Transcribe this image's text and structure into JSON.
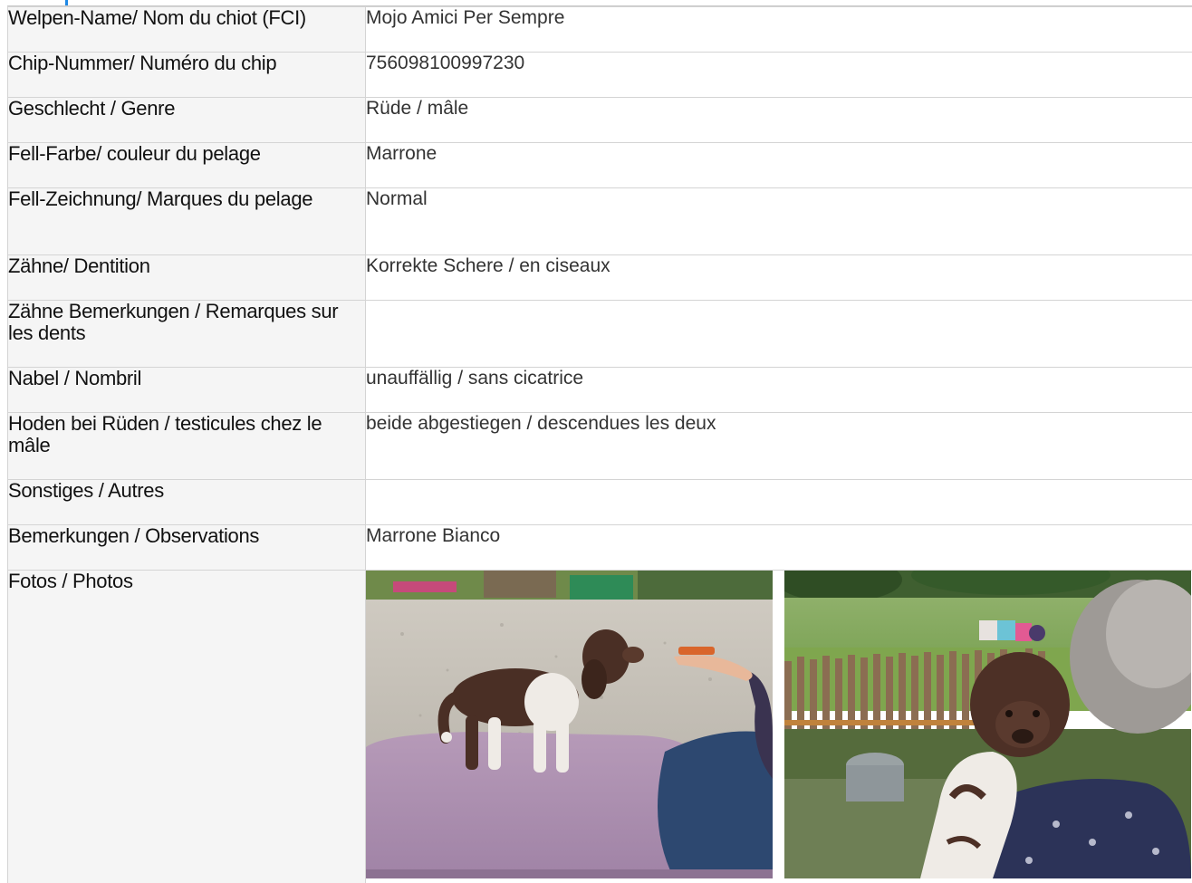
{
  "rows": [
    {
      "label": "Welpen-Name/ Nom du chiot (FCI)",
      "value": "Mojo Amici Per Sempre"
    },
    {
      "label": "Chip-Nummer/ Numéro du chip",
      "value": "756098100997230"
    },
    {
      "label": "Geschlecht / Genre",
      "value": "Rüde / mâle"
    },
    {
      "label": "Fell-Farbe/ couleur du pelage",
      "value": "Marrone"
    },
    {
      "label": "Fell-Zeichnung/ Marques du pelage",
      "value": "Normal"
    },
    {
      "label": "Zähne/ Dentition",
      "value": "Korrekte Schere / en ciseaux"
    },
    {
      "label": "Zähne Bemerkungen / Remarques sur les dents",
      "value": ""
    },
    {
      "label": "Nabel / Nombril",
      "value": "unauffällig / sans cicatrice"
    },
    {
      "label": "Hoden bei Rüden / testicules chez le mâle",
      "value": "beide abgestiegen / descendues les deux"
    },
    {
      "label": "Sonstiges / Autres",
      "value": ""
    },
    {
      "label": "Bemerkungen / Observations",
      "value": "Marrone Bianco"
    }
  ],
  "photos_label": "Fotos / Photos",
  "colors": {
    "label_bg": "#f5f5f5",
    "border": "#d4d4d4",
    "accent": "#1e88e5"
  }
}
